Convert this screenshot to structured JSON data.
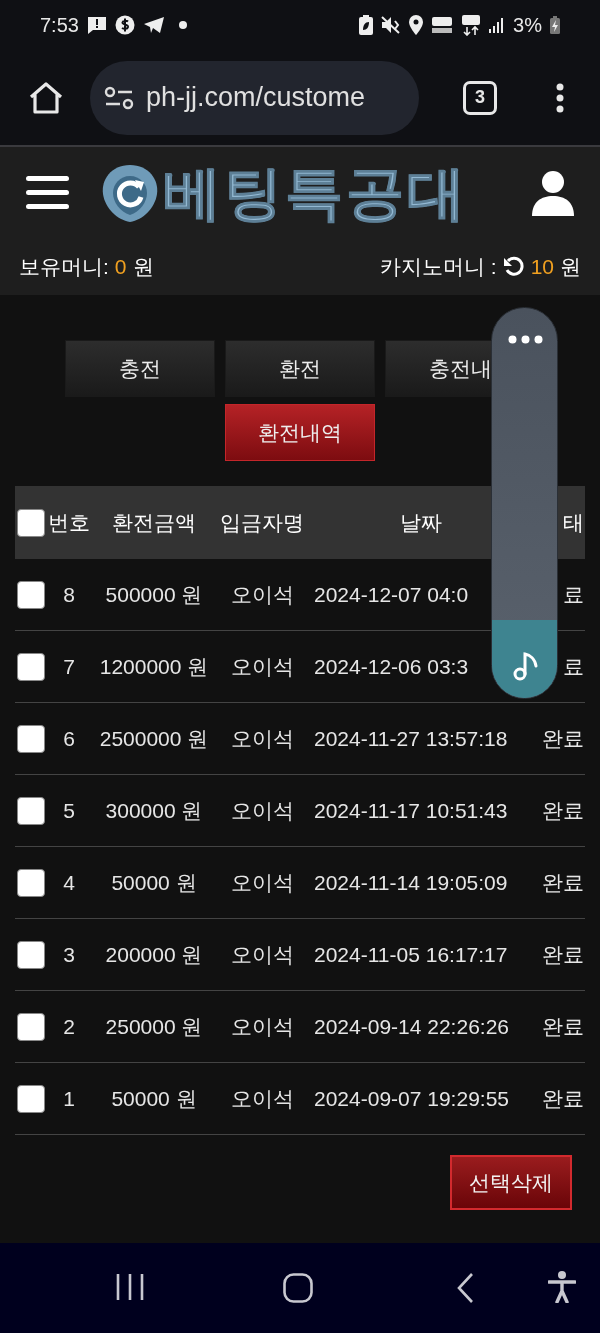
{
  "status_bar": {
    "time": "7:53",
    "battery": "3%"
  },
  "browser": {
    "url": "ph-jj.com/custome",
    "tab_count": "3"
  },
  "site_header": {
    "logo_text": "베팅특공대"
  },
  "wallet": {
    "balance_label": "보유머니:",
    "balance_amount": "0",
    "balance_unit": "원",
    "casino_label": "카지노머니 :",
    "casino_amount": "10",
    "casino_unit": "원"
  },
  "tabs": [
    {
      "label": "충전",
      "selected": false
    },
    {
      "label": "환전",
      "selected": false
    },
    {
      "label": "충전내",
      "selected": false
    },
    {
      "label": "환전내역",
      "selected": true
    }
  ],
  "table": {
    "select_all_checked": false,
    "columns": [
      "번호",
      "환전금액",
      "입금자명",
      "날짜",
      "태"
    ],
    "rows": [
      {
        "checked": false,
        "number": "8",
        "amount": "500000 원",
        "name": "오이석",
        "date": "2024-12-07 04:0",
        "status": "료"
      },
      {
        "checked": false,
        "number": "7",
        "amount": "1200000 원",
        "name": "오이석",
        "date": "2024-12-06 03:3",
        "status": "료"
      },
      {
        "checked": false,
        "number": "6",
        "amount": "2500000 원",
        "name": "오이석",
        "date": "2024-11-27 13:57:18",
        "status": "완료"
      },
      {
        "checked": false,
        "number": "5",
        "amount": "300000 원",
        "name": "오이석",
        "date": "2024-11-17 10:51:43",
        "status": "완료"
      },
      {
        "checked": false,
        "number": "4",
        "amount": "50000 원",
        "name": "오이석",
        "date": "2024-11-14 19:05:09",
        "status": "완료"
      },
      {
        "checked": false,
        "number": "3",
        "amount": "200000 원",
        "name": "오이석",
        "date": "2024-11-05 16:17:17",
        "status": "완료"
      },
      {
        "checked": false,
        "number": "2",
        "amount": "250000 원",
        "name": "오이석",
        "date": "2024-09-14 22:26:26",
        "status": "완료"
      },
      {
        "checked": false,
        "number": "1",
        "amount": "50000 원",
        "name": "오이석",
        "date": "2024-09-07 19:29:55",
        "status": "완료"
      }
    ]
  },
  "delete_button": "선택삭제",
  "volume_overlay": {
    "level": 0.2
  }
}
